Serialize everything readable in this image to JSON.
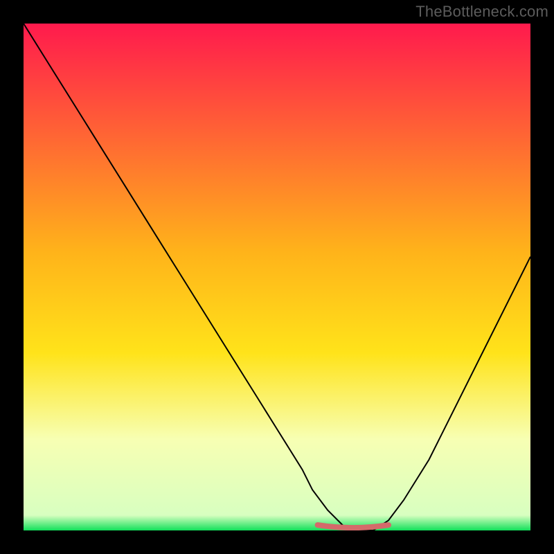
{
  "watermark": "TheBottleneck.com",
  "colors": {
    "frame": "#000000",
    "watermark": "#5c5c5c",
    "curve": "#000000",
    "marker": "#d46a6a",
    "gradient_top": "#ff1a4d",
    "gradient_mid": "#ffd91a",
    "gradient_lower": "#f7ffb3",
    "gradient_bottom": "#11e05a"
  },
  "chart_data": {
    "type": "line",
    "title": "",
    "xlabel": "",
    "ylabel": "",
    "xlim": [
      0,
      100
    ],
    "ylim": [
      0,
      100
    ],
    "series": [
      {
        "name": "bottleneck-curve",
        "x": [
          0,
          5,
          10,
          15,
          20,
          25,
          30,
          35,
          40,
          45,
          50,
          55,
          57,
          60,
          63,
          66,
          69,
          72,
          75,
          80,
          85,
          90,
          95,
          100
        ],
        "values": [
          100,
          92,
          84,
          76,
          68,
          60,
          52,
          44,
          36,
          28,
          20,
          12,
          8,
          4,
          1,
          0,
          0,
          2,
          6,
          14,
          24,
          34,
          44,
          54
        ]
      }
    ],
    "marker_range_x": [
      58,
      72
    ],
    "marker_y": 0.8,
    "gradient_stops": [
      {
        "offset": 0.0,
        "color": "#ff1a4d"
      },
      {
        "offset": 0.45,
        "color": "#ffb31a"
      },
      {
        "offset": 0.65,
        "color": "#ffe31a"
      },
      {
        "offset": 0.82,
        "color": "#f7ffb3"
      },
      {
        "offset": 0.97,
        "color": "#d8ffc0"
      },
      {
        "offset": 1.0,
        "color": "#11e05a"
      }
    ]
  }
}
